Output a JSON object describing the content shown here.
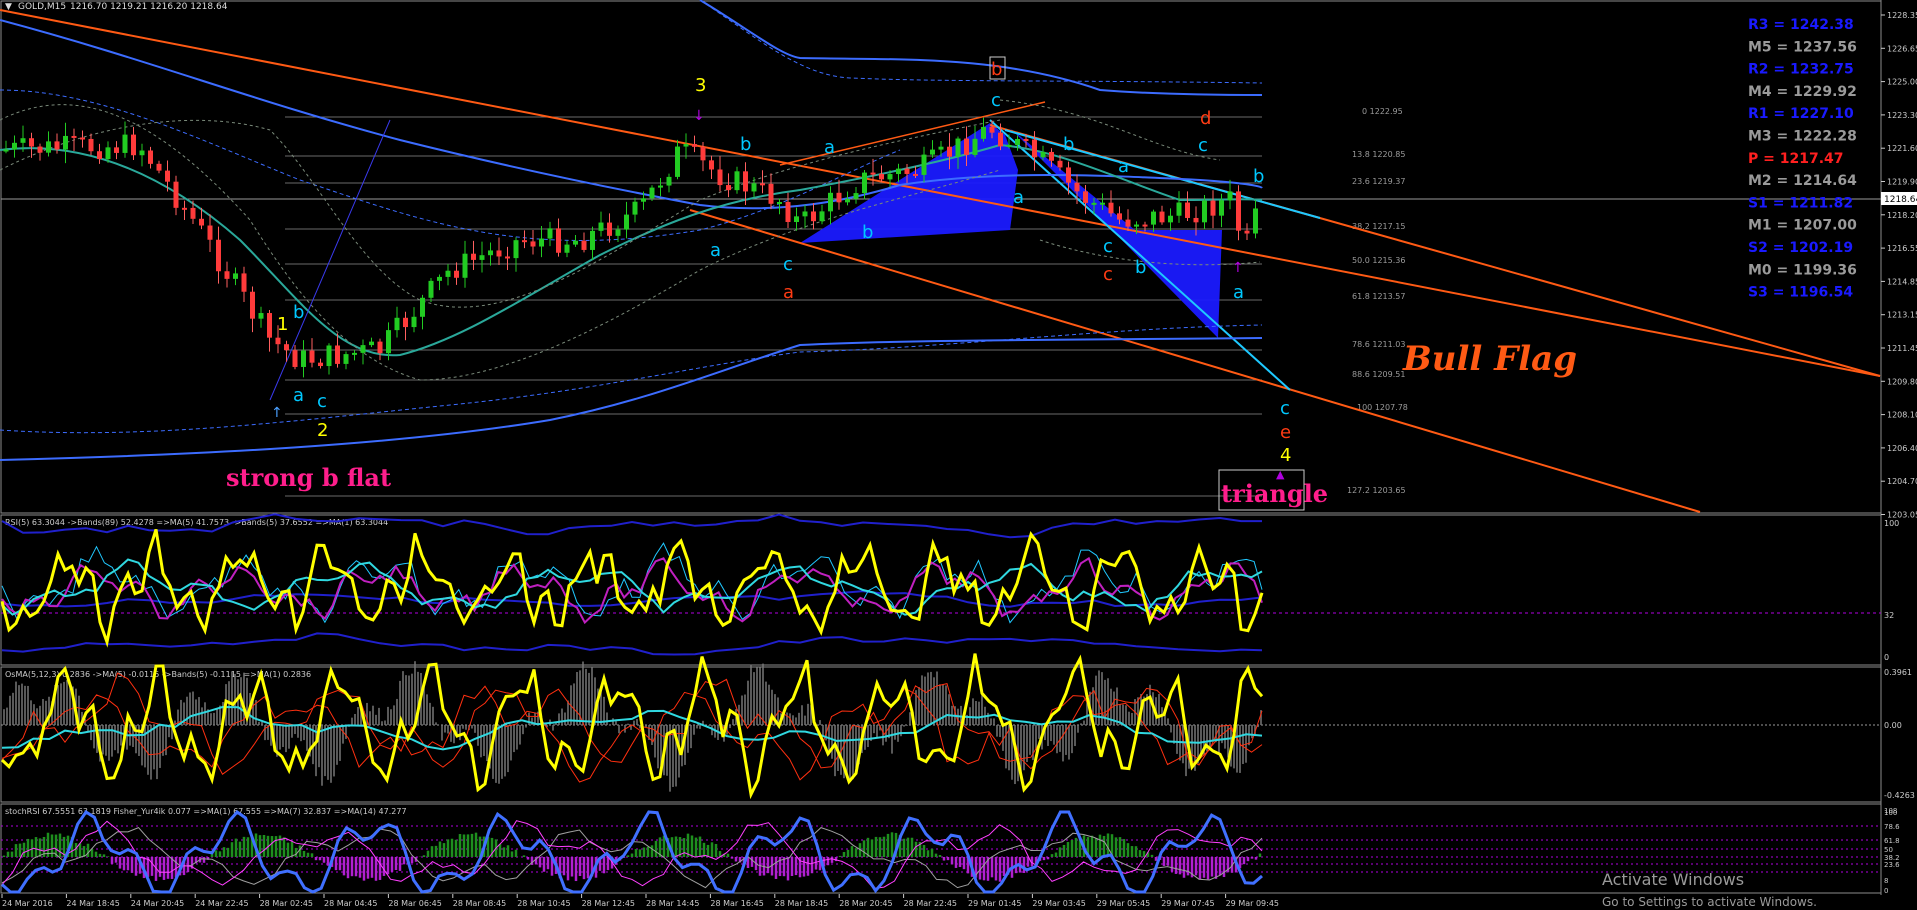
{
  "main_panel": {
    "title": "GOLD,M15",
    "ohlc": "1216.70 1219.21 1216.20 1218.64",
    "current_price": "1218.64",
    "price_axis": [
      "1228.35",
      "1226.65",
      "1225.00",
      "1223.30",
      "1221.60",
      "1219.90",
      "1218.20",
      "1216.55",
      "1214.85",
      "1213.15",
      "1211.45",
      "1209.80",
      "1208.10",
      "1206.40",
      "1204.70",
      "1203.05"
    ],
    "pivots": [
      {
        "label": "R3 = 1242.38",
        "color": "#1a1aff"
      },
      {
        "label": "M5 = 1237.56",
        "color": "#9a9a9a"
      },
      {
        "label": "R2 = 1232.75",
        "color": "#1a1aff"
      },
      {
        "label": "M4 = 1229.92",
        "color": "#9a9a9a"
      },
      {
        "label": "R1 = 1227.10",
        "color": "#1a1aff"
      },
      {
        "label": "M3 = 1222.28",
        "color": "#9a9a9a"
      },
      {
        "label": "P   = 1217.47",
        "color": "#ff2020"
      },
      {
        "label": "M2 = 1214.64",
        "color": "#9a9a9a"
      },
      {
        "label": "S1 = 1211.82",
        "color": "#1a1aff"
      },
      {
        "label": "M1 = 1207.00",
        "color": "#9a9a9a"
      },
      {
        "label": "S2 = 1202.19",
        "color": "#1a1aff"
      },
      {
        "label": "M0 = 1199.36",
        "color": "#9a9a9a"
      },
      {
        "label": "S3 = 1196.54",
        "color": "#1a1aff"
      }
    ],
    "fib_levels": [
      "0 1222.95",
      "13.8 1220.85",
      "23.6 1219.37",
      "38.2 1217.15",
      "50.0 1215.36",
      "61.8 1213.57",
      "78.6 1211.03",
      "88.6 1209.51",
      "100 1207.78",
      "127.2 1203.65"
    ],
    "wave_labels": [
      {
        "text": "1",
        "color": "#ffff00"
      },
      {
        "text": "2",
        "color": "#ffff00"
      },
      {
        "text": "3",
        "color": "#ffff00"
      },
      {
        "text": "4",
        "color": "#ffff00"
      },
      {
        "text": "a",
        "color": "#00c8ff"
      },
      {
        "text": "b",
        "color": "#00c8ff"
      },
      {
        "text": "c",
        "color": "#00c8ff"
      },
      {
        "text": "a",
        "color": "#ff3c14"
      },
      {
        "text": "b",
        "color": "#ff3c14"
      },
      {
        "text": "c",
        "color": "#ff3c14"
      },
      {
        "text": "d",
        "color": "#ff3c14"
      },
      {
        "text": "e",
        "color": "#ff3c14"
      }
    ],
    "annotations": {
      "bull_flag": "Bull Flag",
      "strong_b_flat": "strong b flat",
      "triangle": "triangle"
    }
  },
  "rsi_panel": {
    "header": "RSI(5) 63.3044  ->Bands(89) 52.4278  =>MA(5) 41.7573  ->Bands(5) 37.6552  =>MA(1) 63.3044",
    "axis": [
      "100",
      "32",
      "0"
    ]
  },
  "osma_panel": {
    "header": "OsMA(5,12,3) 0.2836  ->MA(5) -0.0115  ->Bands(5) -0.1115  =>MA(1) 0.2836",
    "axis": [
      "0.3961",
      "0.00",
      "-0.4263"
    ]
  },
  "stoch_panel": {
    "header": "stochRSI 67.5551 63.1819  Fisher_Yur4ik 0.077  =>MA(1) 67.555  =>MA(7) 32.837  =>MA(14) 47.277",
    "axis": [
      "108",
      "100",
      "78.6",
      "61.8",
      "50",
      "38.2",
      "23.6",
      "8",
      "0"
    ]
  },
  "time_axis": [
    "24 Mar 2016",
    "24 Mar 18:45",
    "24 Mar 20:45",
    "24 Mar 22:45",
    "28 Mar 02:45",
    "28 Mar 04:45",
    "28 Mar 06:45",
    "28 Mar 08:45",
    "28 Mar 10:45",
    "28 Mar 12:45",
    "28 Mar 14:45",
    "28 Mar 16:45",
    "28 Mar 18:45",
    "28 Mar 20:45",
    "28 Mar 22:45",
    "29 Mar 01:45",
    "29 Mar 03:45",
    "29 Mar 05:45",
    "29 Mar 07:45",
    "29 Mar 09:45"
  ],
  "watermark": {
    "line1": "Activate Windows",
    "line2": "Go to Settings to activate Windows."
  }
}
